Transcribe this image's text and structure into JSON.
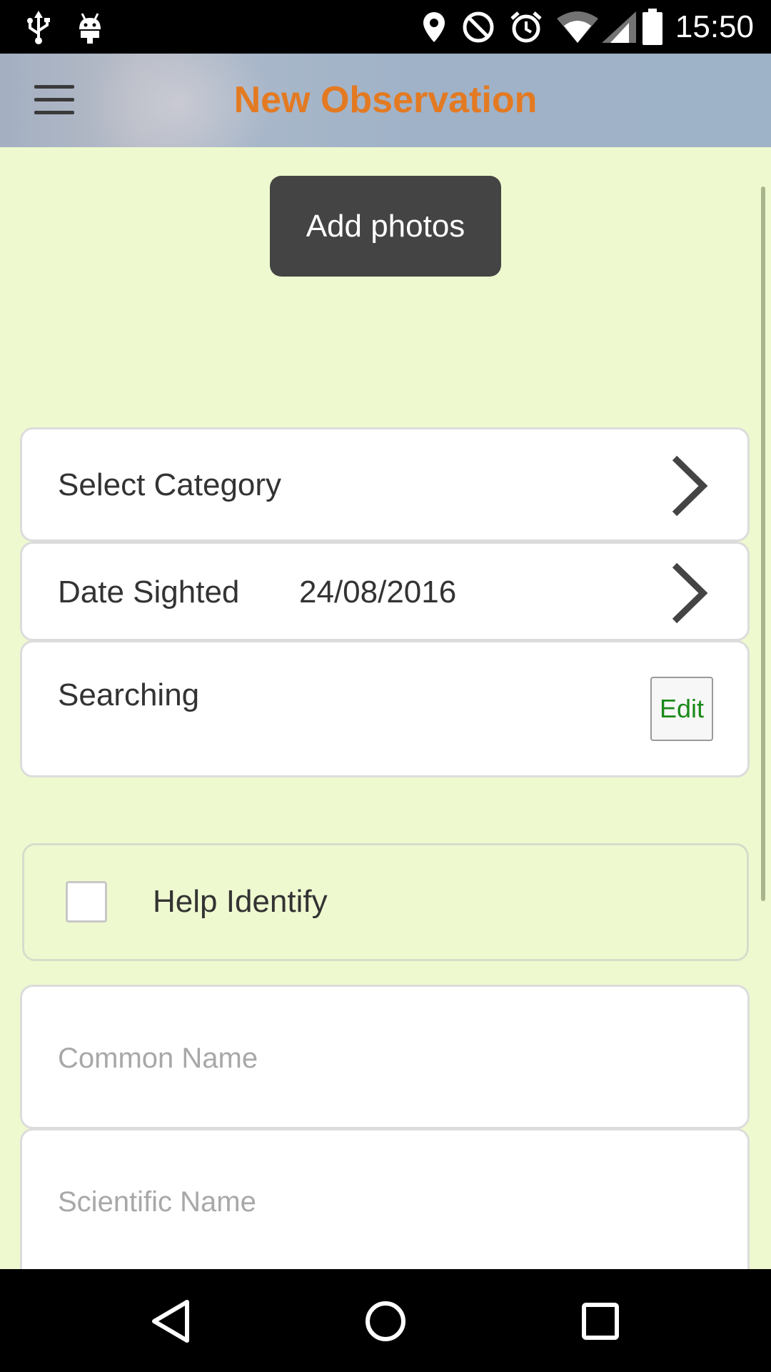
{
  "status_bar": {
    "time": "15:50",
    "icons": [
      "usb-icon",
      "android-debug-icon",
      "location-icon",
      "do-not-disturb-icon",
      "alarm-icon",
      "wifi-icon",
      "cell-signal-icon",
      "battery-icon"
    ]
  },
  "header": {
    "title": "New Observation",
    "menu_icon": "hamburger-menu-icon",
    "title_color": "#e37a22"
  },
  "main": {
    "add_photos_label": "Add photos",
    "category": {
      "label": "Select Category",
      "icon": "chevron-right-icon"
    },
    "date": {
      "label": "Date Sighted",
      "value": "24/08/2016",
      "icon": "chevron-right-icon"
    },
    "location": {
      "label": "Searching",
      "edit_label": "Edit"
    },
    "help_identify": {
      "label": "Help Identify",
      "checked": false
    },
    "common_name": {
      "placeholder": "Common Name",
      "value": ""
    },
    "scientific_name": {
      "placeholder": "Scientific Name",
      "value": ""
    }
  },
  "nav_bar": {
    "buttons": [
      "back-icon",
      "home-icon",
      "recents-icon"
    ]
  },
  "colors": {
    "content_background": "#eef9d0",
    "edit_text": "#1a8a1a",
    "add_photos_background": "#444444"
  }
}
